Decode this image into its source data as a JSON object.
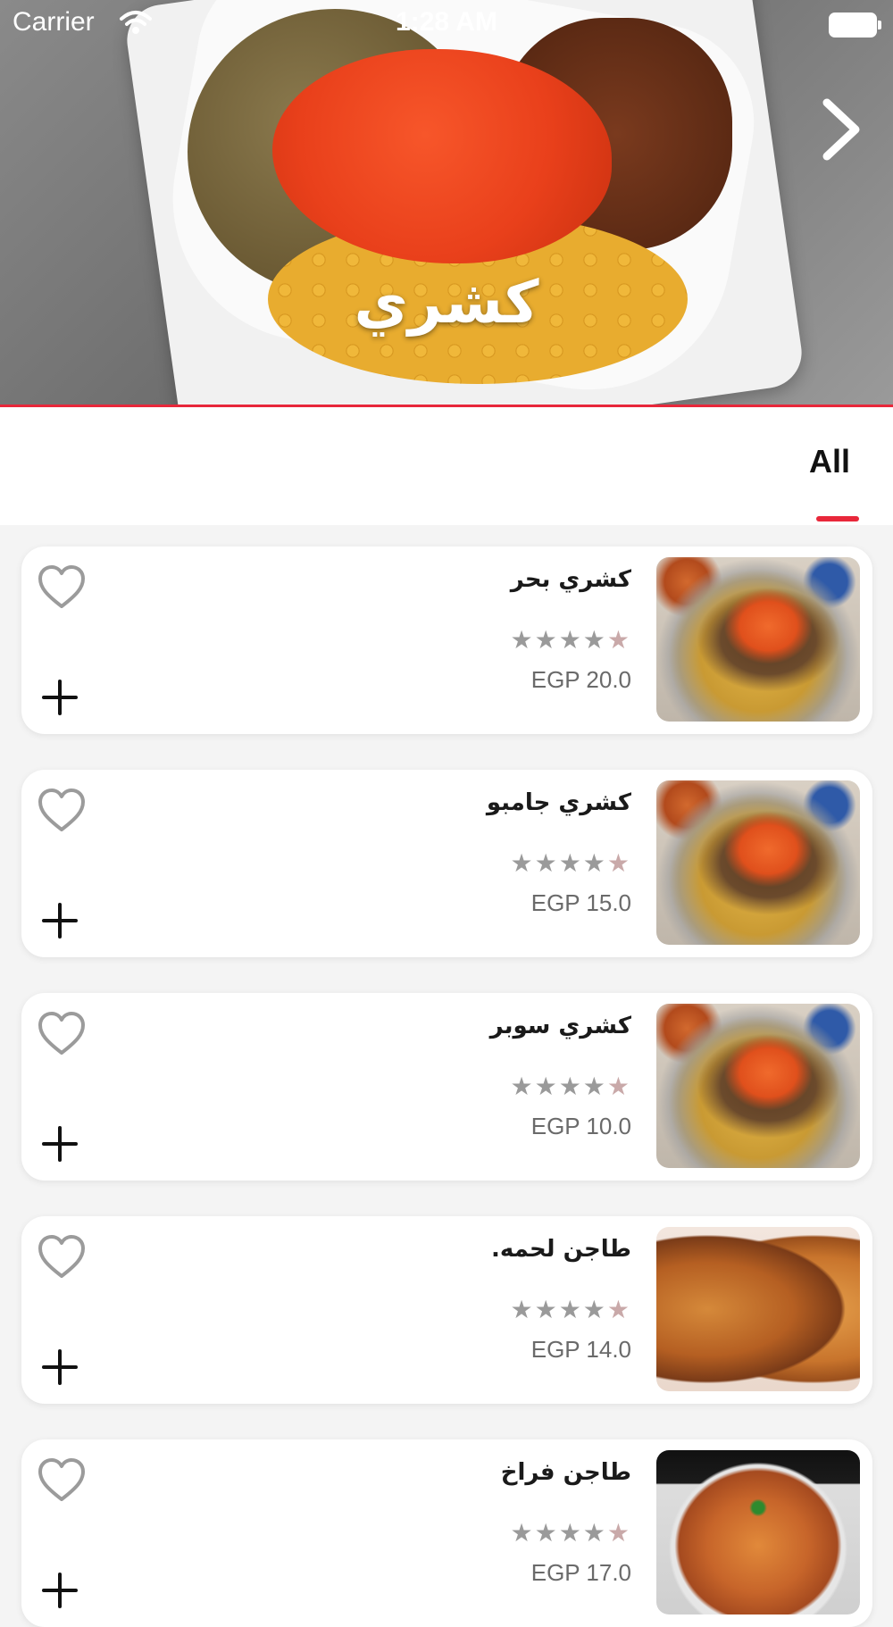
{
  "status_bar": {
    "carrier": "Carrier",
    "time": "1:28 AM"
  },
  "hero": {
    "title": "كشري",
    "next_icon": "chevron-right-icon"
  },
  "tabs": {
    "items": [
      {
        "label": "All",
        "selected": true
      }
    ]
  },
  "menu_items": [
    {
      "name": "كشري بحر",
      "price": "EGP 20.0",
      "rating_stars": 5,
      "image": "koshari"
    },
    {
      "name": "كشري جامبو",
      "price": "EGP 15.0",
      "rating_stars": 5,
      "image": "koshari"
    },
    {
      "name": "كشري سوبر",
      "price": "EGP 10.0",
      "rating_stars": 5,
      "image": "koshari"
    },
    {
      "name": "طاجن لحمه.",
      "price": "EGP 14.0",
      "rating_stars": 5,
      "image": "meat-tagine"
    },
    {
      "name": "طاجن فراخ",
      "price": "EGP 17.0",
      "rating_stars": 5,
      "image": "chicken-tagine"
    }
  ],
  "icons": {
    "favorite": "heart-outline-icon",
    "add": "plus-icon"
  },
  "colors": {
    "accent": "#e8273a",
    "star": "#9a9a9a",
    "price_text": "#6a6a6a"
  }
}
